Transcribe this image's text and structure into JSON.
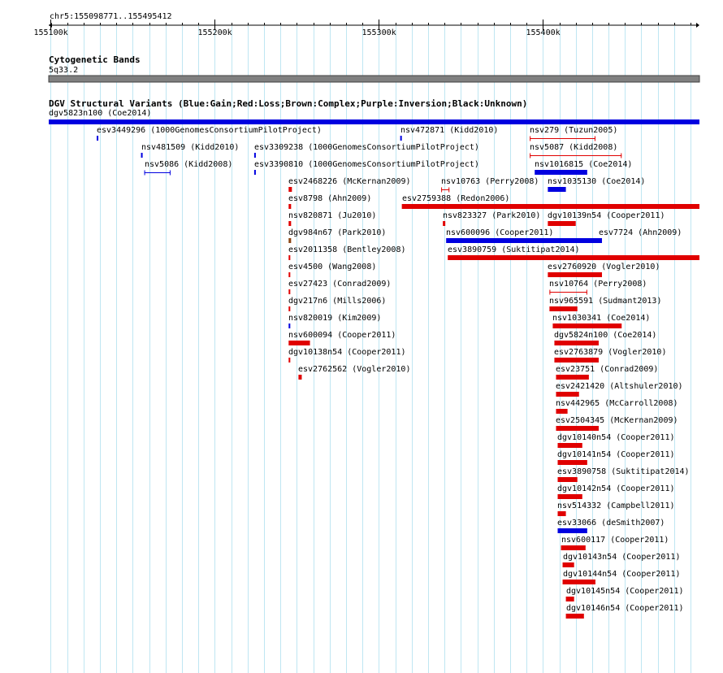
{
  "region": {
    "label": "chr5:155098771..155495412",
    "ticks": [
      {
        "pos": 155100000,
        "label": "155100k"
      },
      {
        "pos": 155200000,
        "label": "155200k"
      },
      {
        "pos": 155300000,
        "label": "155300k"
      },
      {
        "pos": 155400000,
        "label": "155400k"
      }
    ]
  },
  "cytoband": {
    "title": "Cytogenetic Bands",
    "band_label": "5q33.2",
    "color": "#808080"
  },
  "dgv": {
    "title": "DGV Structural Variants (Blue:Gain;Red:Loss;Brown:Complex;Purple:Inversion;Black:Unknown)",
    "colors": {
      "gain": "#0000e0",
      "loss": "#e00000",
      "complex": "#8b4513",
      "inversion": "#800080",
      "unknown": "#000000"
    },
    "features": [
      {
        "label": "dgv5823n100 (Coe2014)",
        "start": 155098771,
        "end": 155495412,
        "row": 0,
        "type": "gain"
      },
      {
        "label": "esv3449296 (1000GenomesConsortiumPilotProject)",
        "start": 155128000,
        "end": 155129000,
        "row": 1,
        "type": "gain"
      },
      {
        "label": "nsv472871 (Kidd2010)",
        "start": 155313000,
        "end": 155314000,
        "row": 1,
        "type": "gain"
      },
      {
        "label": "nsv279 (Tuzun2005)",
        "start": 155392000,
        "end": 155432000,
        "row": 1,
        "type": "loss",
        "style": "interval"
      },
      {
        "label": "nsv481509 (Kidd2010)",
        "start": 155155000,
        "end": 155156000,
        "row": 2,
        "type": "gain"
      },
      {
        "label": "esv3309238 (1000GenomesConsortiumPilotProject)",
        "start": 155224000,
        "end": 155225000,
        "row": 2,
        "type": "gain"
      },
      {
        "label": "nsv5087 (Kidd2008)",
        "start": 155392000,
        "end": 155448000,
        "row": 2,
        "type": "loss",
        "style": "interval"
      },
      {
        "label": "nsv5086 (Kidd2008)",
        "start": 155157000,
        "end": 155173000,
        "row": 3,
        "type": "gain",
        "style": "interval"
      },
      {
        "label": "esv3390810 (1000GenomesConsortiumPilotProject)",
        "start": 155224000,
        "end": 155225000,
        "row": 3,
        "type": "gain"
      },
      {
        "label": "nsv1016815 (Coe2014)",
        "start": 155395000,
        "end": 155427000,
        "row": 3,
        "type": "gain"
      },
      {
        "label": "esv2468226 (McKernan2009)",
        "start": 155245000,
        "end": 155247000,
        "row": 4,
        "type": "loss"
      },
      {
        "label": "nsv10763 (Perry2008)",
        "start": 155338000,
        "end": 155343000,
        "row": 4,
        "type": "loss",
        "style": "interval"
      },
      {
        "label": "nsv1035130 (Coe2014)",
        "start": 155403000,
        "end": 155414000,
        "row": 4,
        "type": "gain"
      },
      {
        "label": "esv8798 (Ahn2009)",
        "start": 155245000,
        "end": 155246500,
        "row": 5,
        "type": "loss"
      },
      {
        "label": "esv2759388 (Redon2006)",
        "start": 155314000,
        "end": 155495412,
        "row": 5,
        "type": "loss"
      },
      {
        "label": "nsv820871 (Ju2010)",
        "start": 155245000,
        "end": 155246500,
        "row": 6,
        "type": "loss"
      },
      {
        "label": "nsv823327 (Park2010)",
        "start": 155339000,
        "end": 155340500,
        "row": 6,
        "type": "loss"
      },
      {
        "label": "dgv10139n54 (Cooper2011)",
        "start": 155403000,
        "end": 155420000,
        "row": 6,
        "type": "loss"
      },
      {
        "label": "dgv984n67 (Park2010)",
        "start": 155245000,
        "end": 155246500,
        "row": 7,
        "type": "complex"
      },
      {
        "label": "nsv600096 (Cooper2011)",
        "start": 155341000,
        "end": 155436000,
        "row": 7,
        "type": "gain"
      },
      {
        "label": "esv7724 (Ahn2009)",
        "start": 155434000,
        "end": 155435500,
        "row": 7,
        "type": "gain"
      },
      {
        "label": "esv2011358 (Bentley2008)",
        "start": 155245000,
        "end": 155246000,
        "row": 8,
        "type": "loss"
      },
      {
        "label": "esv3890759 (Suktitipat2014)",
        "start": 155342000,
        "end": 155495412,
        "row": 8,
        "type": "loss"
      },
      {
        "label": "esv4500 (Wang2008)",
        "start": 155245000,
        "end": 155246000,
        "row": 9,
        "type": "loss"
      },
      {
        "label": "esv2760920 (Vogler2010)",
        "start": 155403000,
        "end": 155436000,
        "row": 9,
        "type": "loss"
      },
      {
        "label": "esv27423 (Conrad2009)",
        "start": 155245000,
        "end": 155246000,
        "row": 10,
        "type": "loss"
      },
      {
        "label": "nsv10764 (Perry2008)",
        "start": 155404000,
        "end": 155427000,
        "row": 10,
        "type": "loss",
        "style": "interval"
      },
      {
        "label": "dgv217n6 (Mills2006)",
        "start": 155245000,
        "end": 155246000,
        "row": 11,
        "type": "loss"
      },
      {
        "label": "nsv965591 (Sudmant2013)",
        "start": 155404000,
        "end": 155421000,
        "row": 11,
        "type": "loss"
      },
      {
        "label": "nsv820019 (Kim2009)",
        "start": 155245000,
        "end": 155246000,
        "row": 12,
        "type": "gain"
      },
      {
        "label": "nsv1030341 (Coe2014)",
        "start": 155406000,
        "end": 155448000,
        "row": 12,
        "type": "loss"
      },
      {
        "label": "nsv600094 (Cooper2011)",
        "start": 155245000,
        "end": 155258000,
        "row": 13,
        "type": "loss"
      },
      {
        "label": "dgv5824n100 (Coe2014)",
        "start": 155407000,
        "end": 155434000,
        "row": 13,
        "type": "loss"
      },
      {
        "label": "dgv10138n54 (Cooper2011)",
        "start": 155245000,
        "end": 155246000,
        "row": 14,
        "type": "loss"
      },
      {
        "label": "esv2763879 (Vogler2010)",
        "start": 155407000,
        "end": 155434000,
        "row": 14,
        "type": "loss"
      },
      {
        "label": "esv2762562 (Vogler2010)",
        "start": 155251000,
        "end": 155253000,
        "row": 15,
        "type": "loss"
      },
      {
        "label": "esv23751 (Conrad2009)",
        "start": 155408000,
        "end": 155428000,
        "row": 15,
        "type": "loss"
      },
      {
        "label": "esv2421420 (Altshuler2010)",
        "start": 155408000,
        "end": 155422000,
        "row": 16,
        "type": "loss"
      },
      {
        "label": "nsv442965 (McCarroll2008)",
        "start": 155408000,
        "end": 155415000,
        "row": 17,
        "type": "loss"
      },
      {
        "label": "esv2504345 (McKernan2009)",
        "start": 155408000,
        "end": 155434000,
        "row": 18,
        "type": "loss"
      },
      {
        "label": "dgv10140n54 (Cooper2011)",
        "start": 155409000,
        "end": 155424000,
        "row": 19,
        "type": "loss"
      },
      {
        "label": "dgv10141n54 (Cooper2011)",
        "start": 155409000,
        "end": 155427000,
        "row": 20,
        "type": "loss"
      },
      {
        "label": "esv3890758 (Suktitipat2014)",
        "start": 155409000,
        "end": 155421000,
        "row": 21,
        "type": "loss"
      },
      {
        "label": "dgv10142n54 (Cooper2011)",
        "start": 155409000,
        "end": 155424000,
        "row": 22,
        "type": "loss"
      },
      {
        "label": "nsv514332 (Campbell2011)",
        "start": 155409000,
        "end": 155414000,
        "row": 23,
        "type": "loss"
      },
      {
        "label": "esv33066 (deSmith2007)",
        "start": 155409000,
        "end": 155427000,
        "row": 24,
        "type": "gain"
      },
      {
        "label": "nsv600117 (Cooper2011)",
        "start": 155411000,
        "end": 155426000,
        "row": 25,
        "type": "loss"
      },
      {
        "label": "dgv10143n54 (Cooper2011)",
        "start": 155412000,
        "end": 155419000,
        "row": 26,
        "type": "loss"
      },
      {
        "label": "dgv10144n54 (Cooper2011)",
        "start": 155412000,
        "end": 155432000,
        "row": 27,
        "type": "loss"
      },
      {
        "label": "dgv10145n54 (Cooper2011)",
        "start": 155414000,
        "end": 155419000,
        "row": 28,
        "type": "loss"
      },
      {
        "label": "dgv10146n54 (Cooper2011)",
        "start": 155414000,
        "end": 155425000,
        "row": 29,
        "type": "loss"
      }
    ]
  }
}
